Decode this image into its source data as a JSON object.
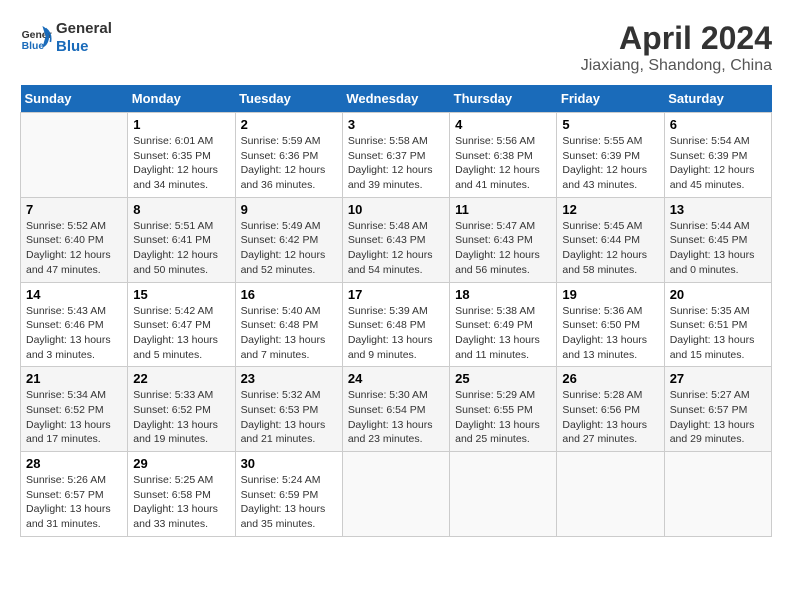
{
  "header": {
    "logo_line1": "General",
    "logo_line2": "Blue",
    "title": "April 2024",
    "subtitle": "Jiaxiang, Shandong, China"
  },
  "weekdays": [
    "Sunday",
    "Monday",
    "Tuesday",
    "Wednesday",
    "Thursday",
    "Friday",
    "Saturday"
  ],
  "weeks": [
    [
      {
        "day": "",
        "info": ""
      },
      {
        "day": "1",
        "info": "Sunrise: 6:01 AM\nSunset: 6:35 PM\nDaylight: 12 hours\nand 34 minutes."
      },
      {
        "day": "2",
        "info": "Sunrise: 5:59 AM\nSunset: 6:36 PM\nDaylight: 12 hours\nand 36 minutes."
      },
      {
        "day": "3",
        "info": "Sunrise: 5:58 AM\nSunset: 6:37 PM\nDaylight: 12 hours\nand 39 minutes."
      },
      {
        "day": "4",
        "info": "Sunrise: 5:56 AM\nSunset: 6:38 PM\nDaylight: 12 hours\nand 41 minutes."
      },
      {
        "day": "5",
        "info": "Sunrise: 5:55 AM\nSunset: 6:39 PM\nDaylight: 12 hours\nand 43 minutes."
      },
      {
        "day": "6",
        "info": "Sunrise: 5:54 AM\nSunset: 6:39 PM\nDaylight: 12 hours\nand 45 minutes."
      }
    ],
    [
      {
        "day": "7",
        "info": "Sunrise: 5:52 AM\nSunset: 6:40 PM\nDaylight: 12 hours\nand 47 minutes."
      },
      {
        "day": "8",
        "info": "Sunrise: 5:51 AM\nSunset: 6:41 PM\nDaylight: 12 hours\nand 50 minutes."
      },
      {
        "day": "9",
        "info": "Sunrise: 5:49 AM\nSunset: 6:42 PM\nDaylight: 12 hours\nand 52 minutes."
      },
      {
        "day": "10",
        "info": "Sunrise: 5:48 AM\nSunset: 6:43 PM\nDaylight: 12 hours\nand 54 minutes."
      },
      {
        "day": "11",
        "info": "Sunrise: 5:47 AM\nSunset: 6:43 PM\nDaylight: 12 hours\nand 56 minutes."
      },
      {
        "day": "12",
        "info": "Sunrise: 5:45 AM\nSunset: 6:44 PM\nDaylight: 12 hours\nand 58 minutes."
      },
      {
        "day": "13",
        "info": "Sunrise: 5:44 AM\nSunset: 6:45 PM\nDaylight: 13 hours\nand 0 minutes."
      }
    ],
    [
      {
        "day": "14",
        "info": "Sunrise: 5:43 AM\nSunset: 6:46 PM\nDaylight: 13 hours\nand 3 minutes."
      },
      {
        "day": "15",
        "info": "Sunrise: 5:42 AM\nSunset: 6:47 PM\nDaylight: 13 hours\nand 5 minutes."
      },
      {
        "day": "16",
        "info": "Sunrise: 5:40 AM\nSunset: 6:48 PM\nDaylight: 13 hours\nand 7 minutes."
      },
      {
        "day": "17",
        "info": "Sunrise: 5:39 AM\nSunset: 6:48 PM\nDaylight: 13 hours\nand 9 minutes."
      },
      {
        "day": "18",
        "info": "Sunrise: 5:38 AM\nSunset: 6:49 PM\nDaylight: 13 hours\nand 11 minutes."
      },
      {
        "day": "19",
        "info": "Sunrise: 5:36 AM\nSunset: 6:50 PM\nDaylight: 13 hours\nand 13 minutes."
      },
      {
        "day": "20",
        "info": "Sunrise: 5:35 AM\nSunset: 6:51 PM\nDaylight: 13 hours\nand 15 minutes."
      }
    ],
    [
      {
        "day": "21",
        "info": "Sunrise: 5:34 AM\nSunset: 6:52 PM\nDaylight: 13 hours\nand 17 minutes."
      },
      {
        "day": "22",
        "info": "Sunrise: 5:33 AM\nSunset: 6:52 PM\nDaylight: 13 hours\nand 19 minutes."
      },
      {
        "day": "23",
        "info": "Sunrise: 5:32 AM\nSunset: 6:53 PM\nDaylight: 13 hours\nand 21 minutes."
      },
      {
        "day": "24",
        "info": "Sunrise: 5:30 AM\nSunset: 6:54 PM\nDaylight: 13 hours\nand 23 minutes."
      },
      {
        "day": "25",
        "info": "Sunrise: 5:29 AM\nSunset: 6:55 PM\nDaylight: 13 hours\nand 25 minutes."
      },
      {
        "day": "26",
        "info": "Sunrise: 5:28 AM\nSunset: 6:56 PM\nDaylight: 13 hours\nand 27 minutes."
      },
      {
        "day": "27",
        "info": "Sunrise: 5:27 AM\nSunset: 6:57 PM\nDaylight: 13 hours\nand 29 minutes."
      }
    ],
    [
      {
        "day": "28",
        "info": "Sunrise: 5:26 AM\nSunset: 6:57 PM\nDaylight: 13 hours\nand 31 minutes."
      },
      {
        "day": "29",
        "info": "Sunrise: 5:25 AM\nSunset: 6:58 PM\nDaylight: 13 hours\nand 33 minutes."
      },
      {
        "day": "30",
        "info": "Sunrise: 5:24 AM\nSunset: 6:59 PM\nDaylight: 13 hours\nand 35 minutes."
      },
      {
        "day": "",
        "info": ""
      },
      {
        "day": "",
        "info": ""
      },
      {
        "day": "",
        "info": ""
      },
      {
        "day": "",
        "info": ""
      }
    ]
  ]
}
